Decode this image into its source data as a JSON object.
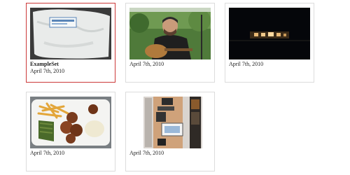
{
  "gallery": {
    "items": [
      {
        "title": "ExampleSet",
        "date": "April 7th, 2010",
        "selected": true,
        "thumb": "plastic-bag-photo"
      },
      {
        "title": "",
        "date": "April 7th, 2010",
        "selected": false,
        "thumb": "guitar-player-photo"
      },
      {
        "title": "",
        "date": "April 7th, 2010",
        "selected": false,
        "thumb": "night-building-photo"
      },
      {
        "title": "",
        "date": "April 7th, 2010",
        "selected": false,
        "thumb": "food-plate-photo"
      },
      {
        "title": "",
        "date": "April 7th, 2010",
        "selected": false,
        "thumb": "desk-electronics-photo"
      }
    ]
  },
  "colors": {
    "selected_border": "#cc3a3a",
    "card_border": "#dcdcdc"
  }
}
